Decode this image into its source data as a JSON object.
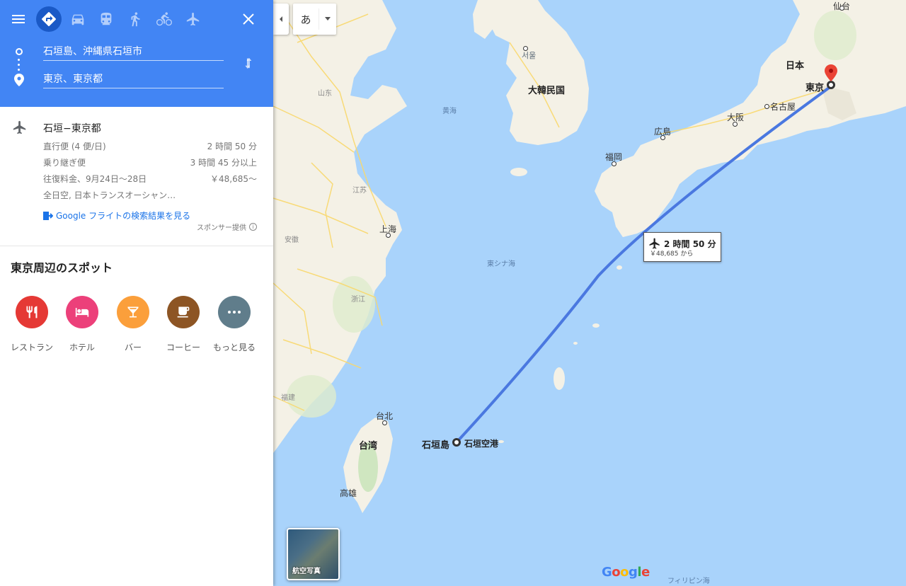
{
  "directions": {
    "modes": [
      "menu-icon",
      "directions-icon",
      "car-icon",
      "transit-icon",
      "walk-icon",
      "bike-icon",
      "flight-icon"
    ],
    "active_mode": "directions-icon",
    "origin": "石垣島、沖縄県石垣市",
    "destination": "東京、東京都"
  },
  "flight": {
    "title": "石垣−東京都",
    "rows": [
      {
        "label": "直行便 (4 便/日)",
        "value": "2 時間 50 分"
      },
      {
        "label": "乗り継ぎ便",
        "value": "3 時間 45 分以上"
      },
      {
        "label": "往復料金、9月24日〜28日",
        "value": "￥48,685〜"
      },
      {
        "label": "全日空, 日本トランスオーシャン…",
        "value": ""
      }
    ],
    "link": "Google フライトの検索結果を見る",
    "sponsor": "スポンサー提供"
  },
  "nearby": {
    "title": "東京周辺のスポット",
    "spots": [
      {
        "label": "レストラン",
        "icon": "restaurant-icon",
        "color": "#e53935"
      },
      {
        "label": "ホテル",
        "icon": "hotel-icon",
        "color": "#ec407a"
      },
      {
        "label": "バー",
        "icon": "bar-icon",
        "color": "#fb9f3b"
      },
      {
        "label": "コーヒー",
        "icon": "coffee-icon",
        "color": "#8d5524"
      },
      {
        "label": "もっと見る",
        "icon": "more-icon",
        "color": "#607d8b"
      }
    ]
  },
  "map": {
    "ime_label": "あ",
    "bubble_time": "2 時間 50 分",
    "bubble_price": "￥48,685 から",
    "satellite_label": "航空写真",
    "logo": "Google",
    "labels": {
      "seoul": "서울",
      "korea": "大韓民国",
      "japan": "日本",
      "tokyo": "東京",
      "nagoya": "名古屋",
      "osaka": "大阪",
      "hiroshima": "広島",
      "fukuoka": "福岡",
      "sendai": "仙台",
      "yellow_sea": "黄海",
      "east_china_sea": "東シナ海",
      "philippine_sea": "フィリピン海",
      "shandong": "山东",
      "jiangsu": "江苏",
      "anhui": "安徽",
      "shanghai": "上海",
      "zhejiang": "浙江",
      "fujian": "福建",
      "taipei": "台北",
      "taiwan": "台湾",
      "kaohsiung": "高雄",
      "ishigaki": "石垣島",
      "ishigaki_airport": "石垣空港"
    },
    "colors": {
      "land": "#f4f1e6",
      "water": "#a9d3fb",
      "route": "#4a78e0",
      "highway": "#f9d86c",
      "green": "#cfe6c0"
    }
  }
}
